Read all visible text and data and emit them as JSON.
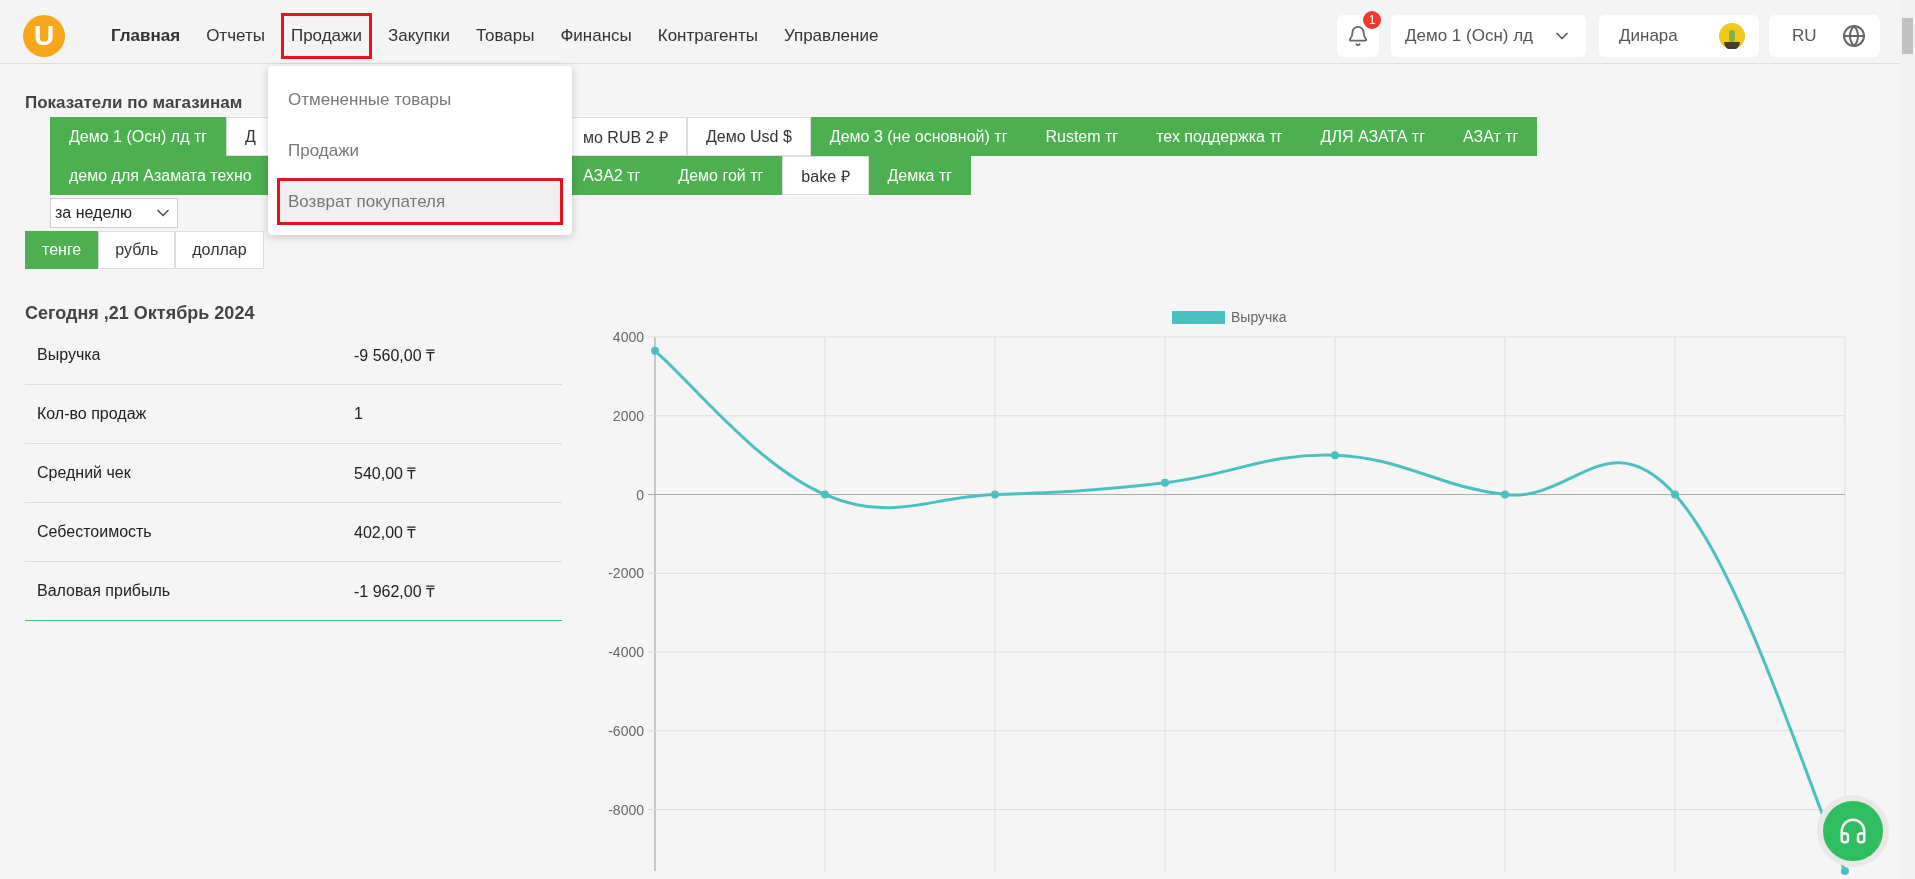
{
  "header": {
    "logo": "U",
    "nav": [
      {
        "label": "Главная",
        "selected": true,
        "highlighted": false
      },
      {
        "label": "Отчеты",
        "selected": false,
        "highlighted": false
      },
      {
        "label": "Продажи",
        "selected": false,
        "highlighted": true
      },
      {
        "label": "Закупки",
        "selected": false,
        "highlighted": false
      },
      {
        "label": "Товары",
        "selected": false,
        "highlighted": false
      },
      {
        "label": "Финансы",
        "selected": false,
        "highlighted": false
      },
      {
        "label": "Контрагенты",
        "selected": false,
        "highlighted": false
      },
      {
        "label": "Управление",
        "selected": false,
        "highlighted": false
      }
    ],
    "notifications": "1",
    "store_select": "Демо 1 (Осн) лд",
    "user": "Динара",
    "language": "RU"
  },
  "dropdown": [
    {
      "label": "Отмененные товары",
      "highlighted": false
    },
    {
      "label": "Продажи",
      "highlighted": false
    },
    {
      "label": "Возврат покупателя",
      "highlighted": true
    }
  ],
  "title": "Показатели по магазинам",
  "store_rows": [
    {
      "left": [
        {
          "label": "Демо 1 (Осн) лд тг",
          "selected": true
        },
        {
          "label": "Д",
          "selected": false
        }
      ],
      "right": [
        {
          "label": "мо RUB 2 ₽",
          "selected": false
        },
        {
          "label": "Демо Usd $",
          "selected": false
        },
        {
          "label": "Демо 3 (не основной) тг",
          "selected": true
        },
        {
          "label": "Rustem тг",
          "selected": true
        },
        {
          "label": "тех поддержка тг",
          "selected": true
        },
        {
          "label": "ДЛЯ АЗАТА тг",
          "selected": true
        },
        {
          "label": "АЗАт тг",
          "selected": true
        }
      ]
    },
    {
      "left": [
        {
          "label": "демо для Азамата техно",
          "selected": true
        }
      ],
      "right": [
        {
          "label": "АЗА2 тг",
          "selected": true
        },
        {
          "label": "Демо гой тг",
          "selected": true
        },
        {
          "label": "bake ₽",
          "selected": false
        },
        {
          "label": "Демка тг",
          "selected": true
        }
      ]
    }
  ],
  "period": "за неделю",
  "currencies": [
    {
      "label": "тенге",
      "selected": true
    },
    {
      "label": "рубль",
      "selected": false
    },
    {
      "label": "доллар",
      "selected": false
    }
  ],
  "summary": {
    "heading": "Сегодня ,21 Октябрь 2024",
    "rows": [
      {
        "label": "Выручка",
        "value": "-9 560,00 ₸"
      },
      {
        "label": "Кол-во продаж",
        "value": "1"
      },
      {
        "label": "Средний чек",
        "value": "540,00 ₸"
      },
      {
        "label": "Себестоимость",
        "value": "402,00 ₸"
      },
      {
        "label": "Валовая прибыль",
        "value": "-1 962,00 ₸"
      }
    ]
  },
  "chart": {
    "chart_data": {
      "type": "line",
      "grid": true,
      "categories": [
        null,
        null,
        null,
        null,
        null,
        null,
        null,
        null
      ],
      "ylim": [
        -9560,
        4000
      ],
      "series": [
        {
          "name": "Выручка",
          "color": "#4bc0c0",
          "marker": "circle",
          "values": [
            3650,
            0,
            0,
            300,
            1000,
            0,
            0,
            -9560
          ]
        }
      ],
      "yticks": [
        4000,
        2000,
        0,
        -2000,
        -4000,
        -6000,
        -8000
      ]
    }
  }
}
